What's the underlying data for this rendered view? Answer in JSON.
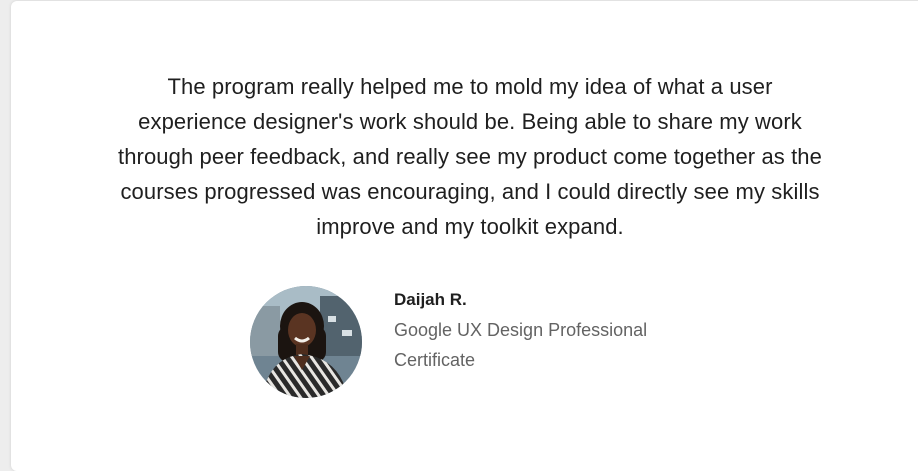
{
  "testimonial": {
    "quote": "The program really helped me to mold my idea of what a user experience designer's work should be. Being able to share my work through peer feedback, and really see my product come together as the courses progressed was encouraging, and I could directly see my skills improve and my toolkit expand.",
    "author_name": "Daijah R.",
    "author_role": "Google UX Design Professional Certificate"
  }
}
